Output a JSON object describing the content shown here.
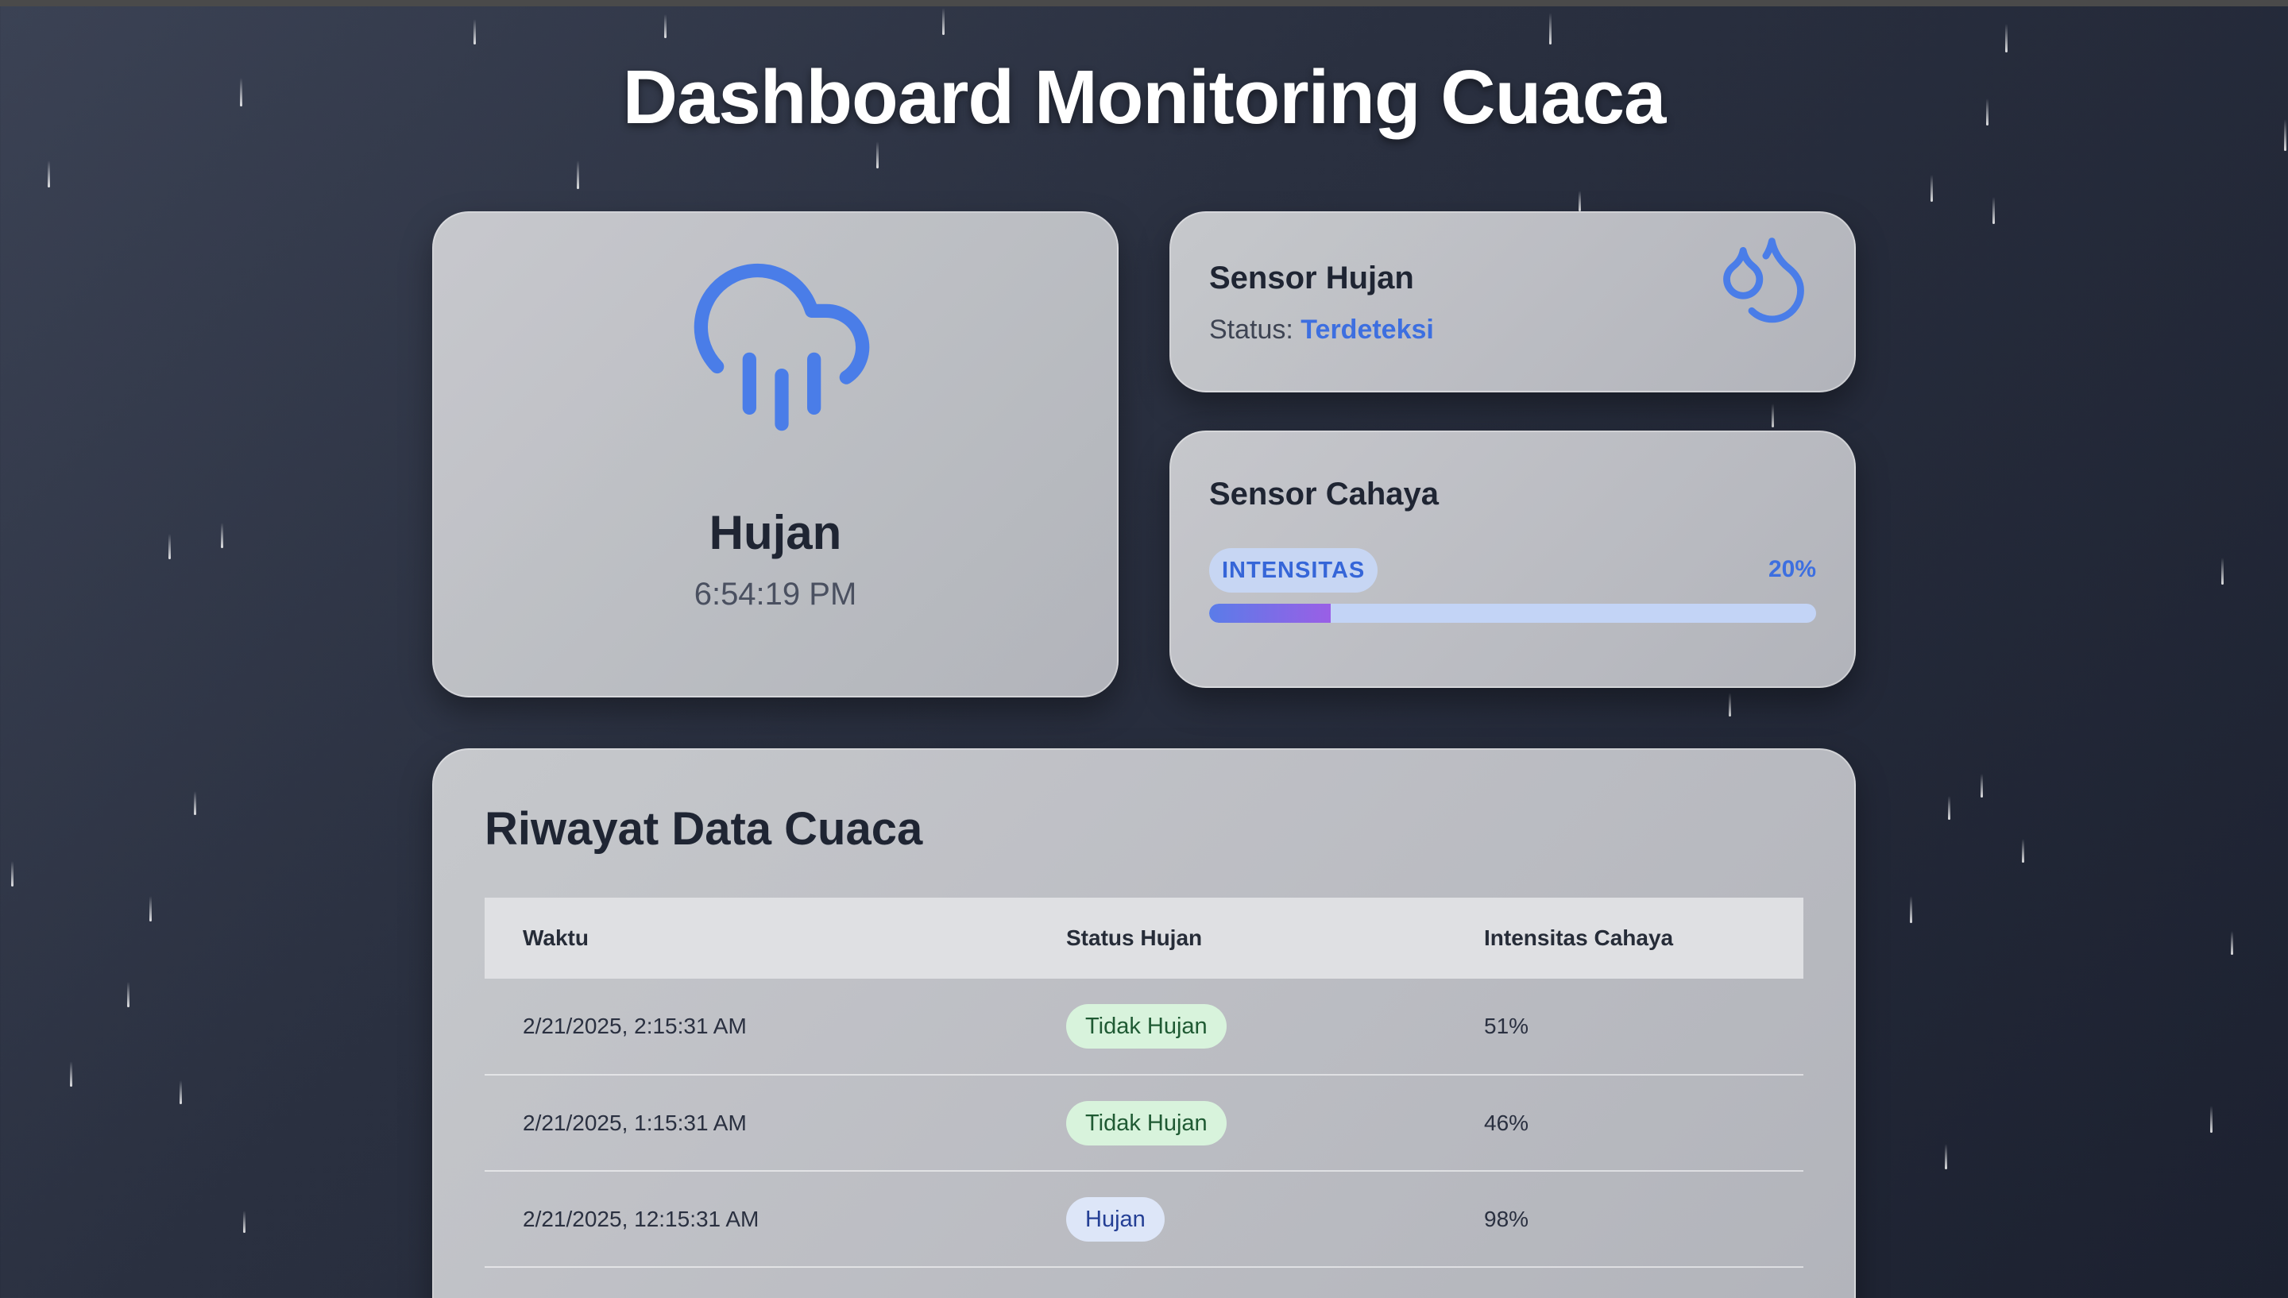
{
  "page": {
    "title": "Dashboard Monitoring Cuaca"
  },
  "weather": {
    "condition": "Hujan",
    "time": "6:54:19 PM",
    "icon": "cloud-rain-icon"
  },
  "rain_sensor": {
    "title": "Sensor Hujan",
    "status_label": "Status:",
    "status_value": "Terdeteksi",
    "icon": "droplets-icon"
  },
  "light_sensor": {
    "title": "Sensor Cahaya",
    "badge": "INTENSITAS",
    "percent_text": "20%",
    "level_fraction": 0.2
  },
  "history": {
    "title": "Riwayat Data Cuaca",
    "columns": [
      "Waktu",
      "Status Hujan",
      "Intensitas Cahaya"
    ],
    "rows": [
      {
        "time": "2/21/2025, 2:15:31 AM",
        "status": "Tidak Hujan",
        "intensity": "51%"
      },
      {
        "time": "2/21/2025, 1:15:31 AM",
        "status": "Tidak Hujan",
        "intensity": "46%"
      },
      {
        "time": "2/21/2025, 12:15:31 AM",
        "status": "Hujan",
        "intensity": "98%"
      }
    ]
  },
  "colors": {
    "accent": "#3d6fe0",
    "background": "#2a3040",
    "dry_badge": "#d8f3dc",
    "wet_badge": "#dde6f8"
  }
}
